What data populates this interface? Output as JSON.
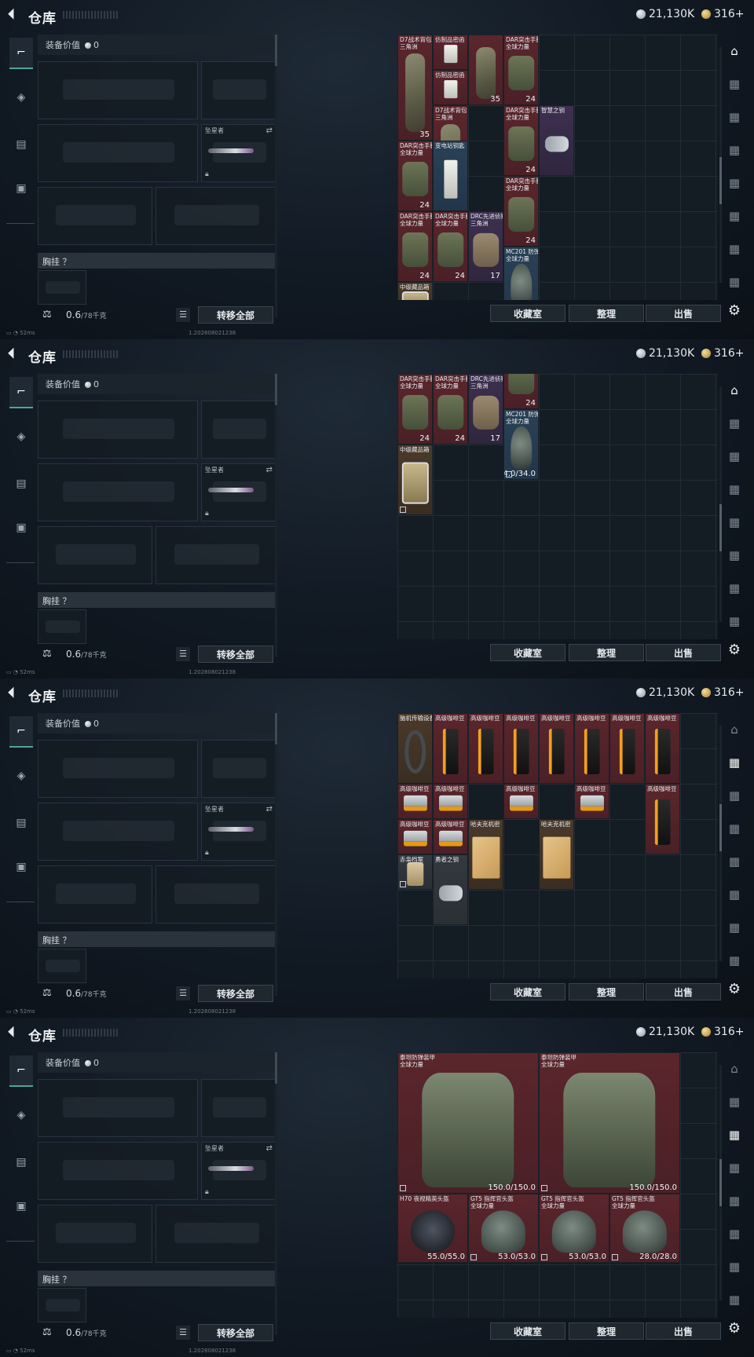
{
  "header": {
    "title": "仓库",
    "silver": "21,130K",
    "gold": "316+"
  },
  "loadout": {
    "value_label": "装备价值",
    "value": "0",
    "melee_label": "坠星者",
    "chest_label": "胸挂 ？",
    "weight_current": "0.6",
    "weight_max": "/78千克",
    "transfer_all": "转移全部"
  },
  "stash_buttons": {
    "collection": "收藏室",
    "sort": "整理",
    "sell": "出售"
  },
  "status": {
    "ping": "52ms",
    "build": "1.202808021238"
  },
  "screens": [
    {
      "active_nav": 0,
      "items": [
        {
          "name": "D7战术背包\n三角洲",
          "rarity": "red",
          "art": "pack",
          "count": "35"
        },
        {
          "name": "仿制品密函",
          "rarity": "red",
          "art": "paper",
          "count": ""
        },
        {
          "name": "仿制品密函",
          "rarity": "red",
          "art": "paper",
          "count": ""
        },
        {
          "name": "",
          "rarity": "red",
          "art": "pack",
          "count": "35"
        },
        {
          "name": "DAR突击手胸挂\n全球力量",
          "rarity": "red",
          "art": "rig",
          "count": "24"
        },
        {
          "name": "D7战术背包\n三角洲",
          "rarity": "red",
          "art": "pack",
          "count": "35"
        },
        {
          "name": "DAR突击手胸挂\n全球力量",
          "rarity": "red",
          "art": "rig",
          "count": "24"
        },
        {
          "name": "智慧之钥",
          "rarity": "purple",
          "art": "key",
          "count": ""
        },
        {
          "name": "DAR突击手胸挂\n全球力量",
          "rarity": "red",
          "art": "rig",
          "count": "24"
        },
        {
          "name": "变电站钥匙",
          "rarity": "blue",
          "art": "paper",
          "count": ""
        },
        {
          "name": "DAR突击手胸挂\n全球力量",
          "rarity": "red",
          "art": "rig",
          "count": "24"
        },
        {
          "name": "DAR突击手胸挂\n全球力量",
          "rarity": "red",
          "art": "rig",
          "count": "24"
        },
        {
          "name": "DAR突击手胸挂\n全球力量",
          "rarity": "red",
          "art": "rig",
          "count": "24"
        },
        {
          "name": "DRC先进侦察胸挂\n三角洲",
          "rarity": "purple",
          "art": "tan",
          "count": "17"
        },
        {
          "name": "MC201 防弹头盔\n全球力量",
          "rarity": "blue",
          "art": "helmet",
          "count": ""
        },
        {
          "name": "中级藏品箱",
          "rarity": "brown",
          "art": "box",
          "count": ""
        }
      ]
    },
    {
      "active_nav": 0,
      "items": [
        {
          "name": "DAR突击手胸挂\n全球力量",
          "rarity": "red",
          "art": "rig",
          "count": "24"
        },
        {
          "name": "DAR突击手胸挂\n全球力量",
          "rarity": "red",
          "art": "rig",
          "count": "24"
        },
        {
          "name": "DRC先进侦察胸挂\n三角洲",
          "rarity": "purple",
          "art": "tan",
          "count": "17"
        },
        {
          "name": "",
          "rarity": "red",
          "art": "rig",
          "count": "24"
        },
        {
          "name": "MC201 防弹头盔\n全球力量",
          "rarity": "blue",
          "art": "helmet",
          "count": "34.0/34.0"
        },
        {
          "name": "中级藏品箱",
          "rarity": "brown",
          "art": "box",
          "count": ""
        }
      ]
    },
    {
      "active_nav": 1,
      "items": [
        {
          "name": "脑机传输设备",
          "rarity": "brown",
          "art": "headset",
          "count": ""
        },
        {
          "name": "高级咖啡豆",
          "rarity": "red",
          "art": "coffee",
          "count": ""
        },
        {
          "name": "高级咖啡豆",
          "rarity": "red",
          "art": "coffee",
          "count": ""
        },
        {
          "name": "高级咖啡豆",
          "rarity": "red",
          "art": "coffee",
          "count": ""
        },
        {
          "name": "高级咖啡豆",
          "rarity": "red",
          "art": "coffee",
          "count": ""
        },
        {
          "name": "高级咖啡豆",
          "rarity": "red",
          "art": "coffee",
          "count": ""
        },
        {
          "name": "高级咖啡豆",
          "rarity": "red",
          "art": "coffee",
          "count": ""
        },
        {
          "name": "高级咖啡豆",
          "rarity": "red",
          "art": "coffee",
          "count": ""
        },
        {
          "name": "高级咖啡豆",
          "rarity": "red",
          "art": "coffeebox",
          "count": ""
        },
        {
          "name": "高级咖啡豆",
          "rarity": "red",
          "art": "coffeebox",
          "count": ""
        },
        {
          "name": "高级咖啡豆",
          "rarity": "red",
          "art": "coffeebox",
          "count": ""
        },
        {
          "name": "高级咖啡豆",
          "rarity": "red",
          "art": "coffeebox",
          "count": ""
        },
        {
          "name": "高级咖啡豆",
          "rarity": "red",
          "art": "coffee",
          "count": ""
        },
        {
          "name": "高级咖啡豆",
          "rarity": "red",
          "art": "coffeebox",
          "count": ""
        },
        {
          "name": "高级咖啡豆",
          "rarity": "red",
          "art": "coffeebox",
          "count": ""
        },
        {
          "name": "哈夫克机密",
          "rarity": "brown",
          "art": "map",
          "count": ""
        },
        {
          "name": "哈夫克机密",
          "rarity": "brown",
          "art": "map",
          "count": ""
        },
        {
          "name": "赤枭档案",
          "rarity": "gray",
          "art": "file",
          "count": ""
        },
        {
          "name": "勇者之钥",
          "rarity": "gray",
          "art": "key",
          "count": ""
        }
      ]
    },
    {
      "active_nav": 2,
      "items": [
        {
          "name": "泰坦防弹装甲\n全球力量",
          "rarity": "red",
          "art": "armor",
          "count": "150.0/150.0"
        },
        {
          "name": "泰坦防弹装甲\n全球力量",
          "rarity": "red",
          "art": "armor",
          "count": "150.0/150.0"
        },
        {
          "name": "H70 夜视精英头盔",
          "rarity": "red",
          "art": "nvg",
          "count": "55.0/55.0"
        },
        {
          "name": "GT5 指挥官头盔\n全球力量",
          "rarity": "red",
          "art": "helmet",
          "count": "53.0/53.0"
        },
        {
          "name": "GT5 指挥官头盔\n全球力量",
          "rarity": "red",
          "art": "helmet",
          "count": "53.0/53.0"
        },
        {
          "name": "GT5 指挥官头盔\n全球力量",
          "rarity": "red",
          "art": "helmet",
          "count": "28.0/28.0"
        }
      ]
    }
  ],
  "icons": {
    "back": "back-arrow-icon",
    "side": [
      "gun-icon",
      "armor-icon",
      "backpack-icon",
      "briefcase-icon"
    ],
    "right_nav": [
      "stash-home-icon",
      "stash-tab-icon",
      "stash-tab-icon",
      "stash-tab-icon",
      "stash-tab-icon",
      "stash-tab-icon",
      "stash-tab-icon",
      "stash-tab-icon",
      "settings-gear-icon"
    ]
  }
}
